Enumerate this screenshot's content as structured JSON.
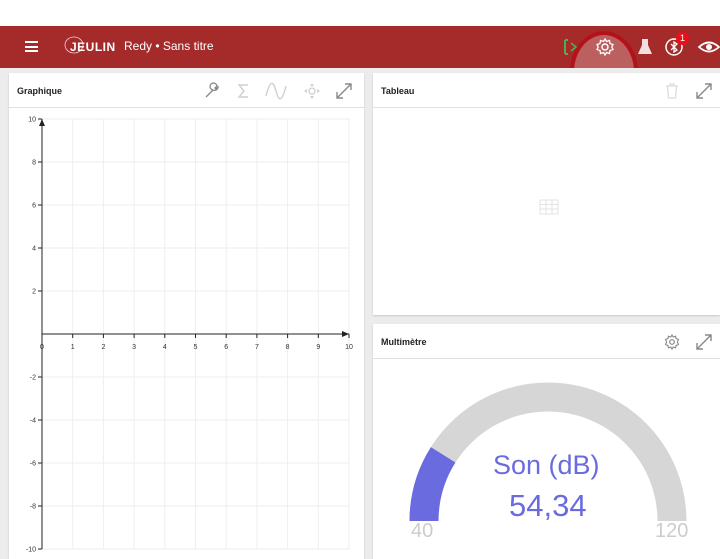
{
  "app": {
    "title": "Redy • Sans titre",
    "brand": "JEULIN"
  },
  "toolbar": {
    "notification_count": "1",
    "accent_color": "#a52a2a"
  },
  "graph_panel": {
    "title": "Graphique",
    "icons": [
      "wrench-icon",
      "sigma-icon",
      "curve-icon",
      "move-icon",
      "expand-icon"
    ]
  },
  "table_panel": {
    "title": "Tableau",
    "icons": [
      "trash-icon",
      "expand-icon",
      "table-grid-icon"
    ]
  },
  "multimeter_panel": {
    "title": "Multimètre",
    "quantity": "Son (dB)",
    "value": "54,34",
    "value_number": 54.34,
    "min": "40",
    "max": "120",
    "gauge_color": "#6b6be0",
    "track_color": "#d6d6d6"
  },
  "chart_data": {
    "type": "line",
    "x_ticks": [
      "0",
      "1",
      "2",
      "3",
      "4",
      "5",
      "6",
      "7",
      "8",
      "9",
      "10"
    ],
    "y_ticks": [
      "10",
      "8",
      "6",
      "4",
      "2",
      "-2",
      "-4",
      "-6",
      "-8",
      "-10"
    ],
    "xlim": [
      0,
      10
    ],
    "ylim": [
      -10,
      10
    ],
    "grid": true,
    "series": []
  }
}
